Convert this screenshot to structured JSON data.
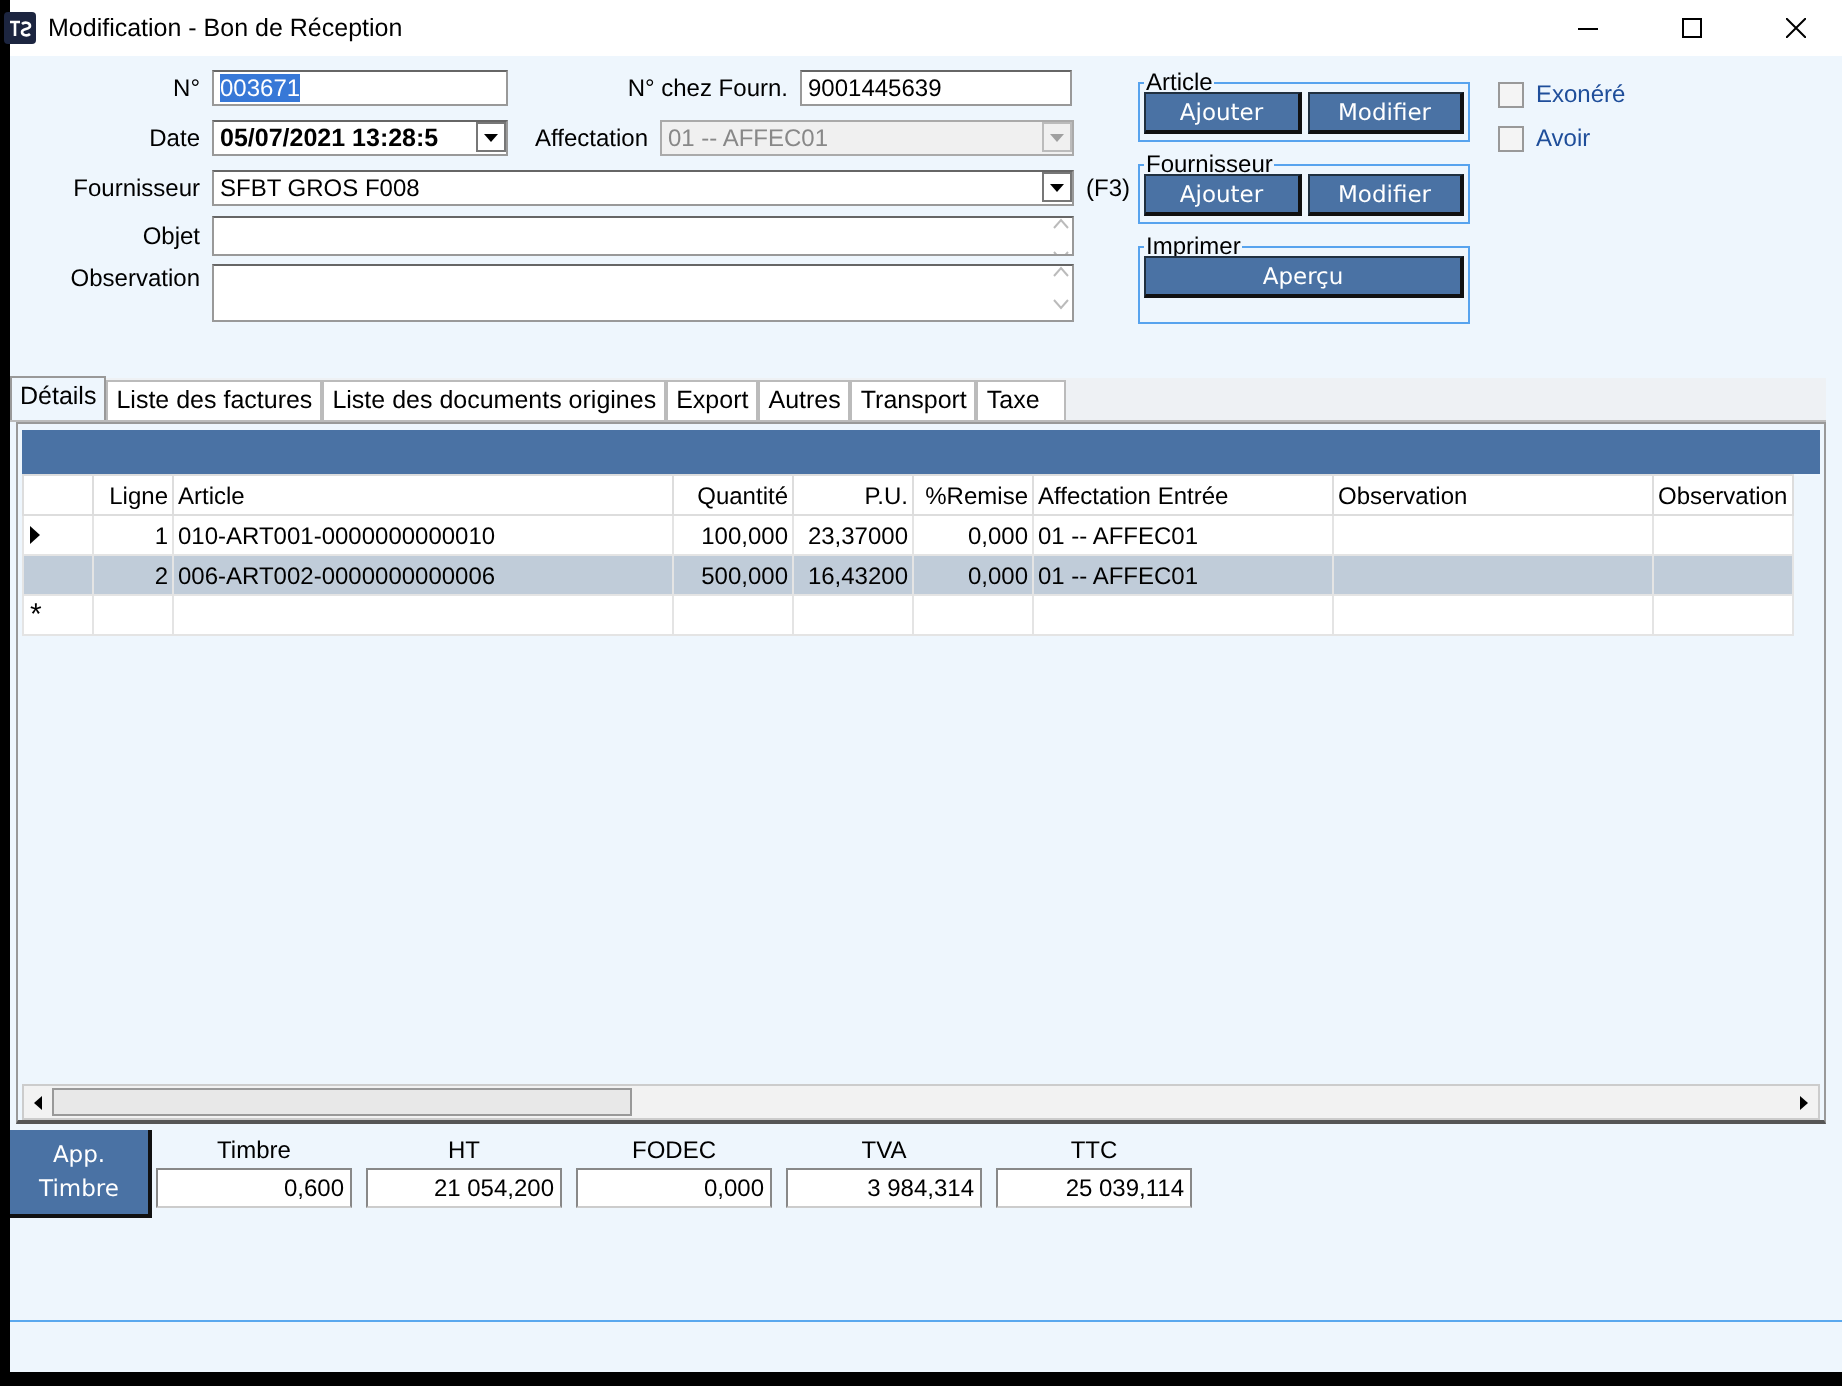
{
  "window": {
    "title": "Modification - Bon de Réception"
  },
  "form": {
    "numero": {
      "label": "N°",
      "value": "003671",
      "highlighted": true
    },
    "numero_fournisseur": {
      "label": "N° chez Fourn.",
      "value": "9001445639"
    },
    "date": {
      "label": "Date",
      "value": "05/07/2021 13:28:5"
    },
    "affectation": {
      "label": "Affectation",
      "value": "01 -- AFFEC01",
      "disabled": true
    },
    "fournisseur": {
      "label": "Fournisseur",
      "value": "SFBT GROS F008",
      "shortcut": "(F3)"
    },
    "objet": {
      "label": "Objet"
    },
    "observation": {
      "label": "Observation"
    }
  },
  "groups": [
    {
      "title": "Article",
      "buttons": [
        "Ajouter",
        "Modifier"
      ]
    },
    {
      "title": "Fournisseur",
      "buttons": [
        "Ajouter",
        "Modifier"
      ]
    },
    {
      "title": "Imprimer",
      "buttons": [
        "Aperçu"
      ]
    }
  ],
  "checkboxes": [
    {
      "label": "Exonéré",
      "checked": false
    },
    {
      "label": "Avoir",
      "checked": false
    }
  ],
  "tabs": [
    {
      "label": "Détails",
      "selected": true
    },
    {
      "label": "Liste des factures",
      "selected": false
    },
    {
      "label": "Liste des documents origines",
      "selected": false
    },
    {
      "label": "Export",
      "selected": false
    },
    {
      "label": "Autres",
      "selected": false
    },
    {
      "label": "Transport",
      "selected": false
    },
    {
      "label": "Taxe",
      "selected": false
    }
  ],
  "grid": {
    "columns": [
      "Ligne",
      "Article",
      "Quantité",
      "P.U.",
      "%Remise",
      "Affectation Entrée",
      "Observation",
      "Observation"
    ],
    "rows": [
      {
        "current": true,
        "selected": false,
        "cells": [
          "1",
          "010-ART001-0000000000010",
          "100,000",
          "23,37000",
          "0,000",
          "01 -- AFFEC01",
          "",
          ""
        ]
      },
      {
        "current": false,
        "selected": true,
        "cells": [
          "2",
          "006-ART002-0000000000006",
          "500,000",
          "16,43200",
          "0,000",
          "01 -- AFFEC01",
          "",
          ""
        ]
      }
    ],
    "new_row_marker": "*"
  },
  "timbre_button": "App. Timbre",
  "totals": [
    {
      "label": "Timbre",
      "value": "0,600"
    },
    {
      "label": "HT",
      "value": "21 054,200"
    },
    {
      "label": "FODEC",
      "value": "0,000"
    },
    {
      "label": "TVA",
      "value": "3 984,314"
    },
    {
      "label": "TTC",
      "value": "25 039,114"
    }
  ]
}
